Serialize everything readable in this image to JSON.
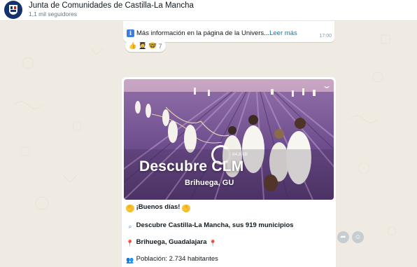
{
  "header": {
    "title": "Junta de Comunidades de Castilla-La Mancha",
    "followers": "1,1 mil seguidores",
    "avatar_icon": "castilla-la-mancha-crest-icon"
  },
  "previous_message": {
    "text": "Más información en la página de la Univers...",
    "read_more": "Leer más",
    "time": "17:00",
    "icon": "info-icon"
  },
  "reactions": {
    "emojis": [
      "👍",
      "🧑‍🎓",
      "🤓"
    ],
    "count": "7"
  },
  "post": {
    "image": {
      "title": "Descubre CLM",
      "subtitle": "Brihuega, GU",
      "loading_label": "84,8 kB",
      "scene": "lavender-field-walkers"
    },
    "lines": [
      {
        "before": "",
        "text": "¡Buenos días!",
        "icon": "clapping-hands-icon"
      },
      {
        "text": "Descubre Castilla-La Mancha, sus 919 municipios",
        "icon": "magnifier-icon"
      },
      {
        "text": "Brihuega, Guadalajara",
        "icon": "pin-icon"
      },
      {
        "text": "Población: 2.734 habitantes",
        "icon": "people-icon"
      }
    ]
  },
  "actions": {
    "forward_icon": "forward-icon",
    "react_icon": "emoji-icon"
  },
  "colors": {
    "chat_bg": "#efeae2",
    "bubble": "#ffffff",
    "link": "#027eb5",
    "lavender": "#7a5a9c"
  }
}
